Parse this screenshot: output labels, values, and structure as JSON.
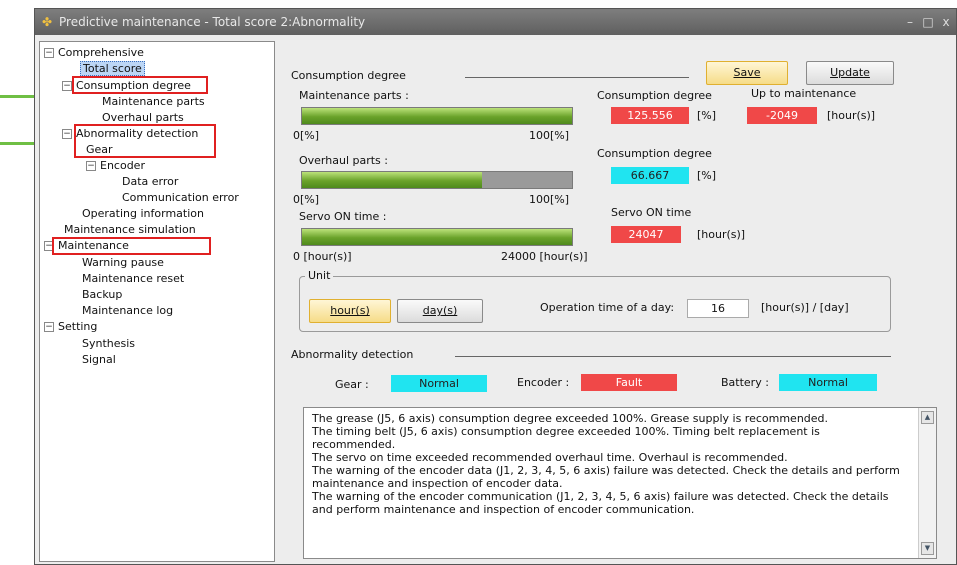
{
  "window": {
    "title": "Predictive maintenance - Total score 2:Abnormality",
    "min": "–",
    "max": "□",
    "close": "x"
  },
  "tree": {
    "comprehensive": "Comprehensive",
    "total_score": "Total score",
    "consumption_degree": "Consumption degree",
    "maintenance_parts": "Maintenance parts",
    "overhaul_parts": "Overhaul parts",
    "abnormality_detection": "Abnormality detection",
    "gear": "Gear",
    "encoder": "Encoder",
    "data_error": "Data error",
    "communication_error": "Communication error",
    "operating_information": "Operating information",
    "maintenance_simulation": "Maintenance simulation",
    "maintenance": "Maintenance",
    "warning_pause": "Warning pause",
    "maintenance_reset": "Maintenance reset",
    "backup": "Backup",
    "maintenance_log": "Maintenance log",
    "setting": "Setting",
    "synthesis": "Synthesis",
    "signal": "Signal",
    "expand_glyph": "⊟"
  },
  "consumption": {
    "section_title": "Consumption degree",
    "save": "Save",
    "update": "Update",
    "maintenance_parts_label": "Maintenance parts :",
    "overhaul_parts_label": "Overhaul parts :",
    "servo_on_label": "Servo ON time :",
    "bar1_min": "0[%]",
    "bar1_max": "100[%]",
    "bar2_min": "0[%]",
    "bar2_max": "100[%]",
    "bar3_min": "0 [hour(s)]",
    "bar3_max": "24000 [hour(s)]",
    "maintenance_parts_fill": 1.0,
    "overhaul_parts_fill": 0.667,
    "servo_on_fill": 1.0,
    "cd_label_1": "Consumption degree",
    "cd_value_1": "125.556",
    "cd_unit_1": "[%]",
    "up_to_label": "Up to maintenance",
    "up_to_value": "-2049",
    "up_to_unit": "[hour(s)]",
    "cd_label_2": "Consumption degree",
    "cd_value_2": "66.667",
    "cd_unit_2": "[%]",
    "servo_label": "Servo ON time",
    "servo_value": "24047",
    "servo_unit": "[hour(s)]"
  },
  "unit": {
    "legend": "Unit",
    "hours": "hour(s)",
    "days": "day(s)",
    "op_label": "Operation time of a day:",
    "op_value": "16",
    "op_unit": "[hour(s)] / [day]"
  },
  "abnormality": {
    "section_title": "Abnormality detection",
    "gear_label": "Gear :",
    "gear_value": "Normal",
    "encoder_label": "Encoder :",
    "encoder_value": "Fault",
    "battery_label": "Battery :",
    "battery_value": "Normal"
  },
  "messages": [
    "The grease (J5, 6 axis) consumption degree exceeded 100%. Grease supply is recommended.",
    "The timing belt (J5, 6 axis) consumption degree exceeded 100%. Timing belt replacement is recommended.",
    "The servo on time exceeded recommended overhaul time. Overhaul is recommended.",
    "The warning of the encoder data (J1, 2, 3, 4, 5, 6 axis) failure was detected. Check the details and perform maintenance and inspection of encoder data.",
    "The warning of the encoder communication (J1, 2, 3, 4, 5, 6 axis) failure was detected. Check the details and perform maintenance and inspection of encoder communication."
  ],
  "colors": {
    "fault": "#f04848",
    "normal": "#20e4f0",
    "annotation_green": "#6fbf44",
    "annotation_red": "#e02020"
  }
}
